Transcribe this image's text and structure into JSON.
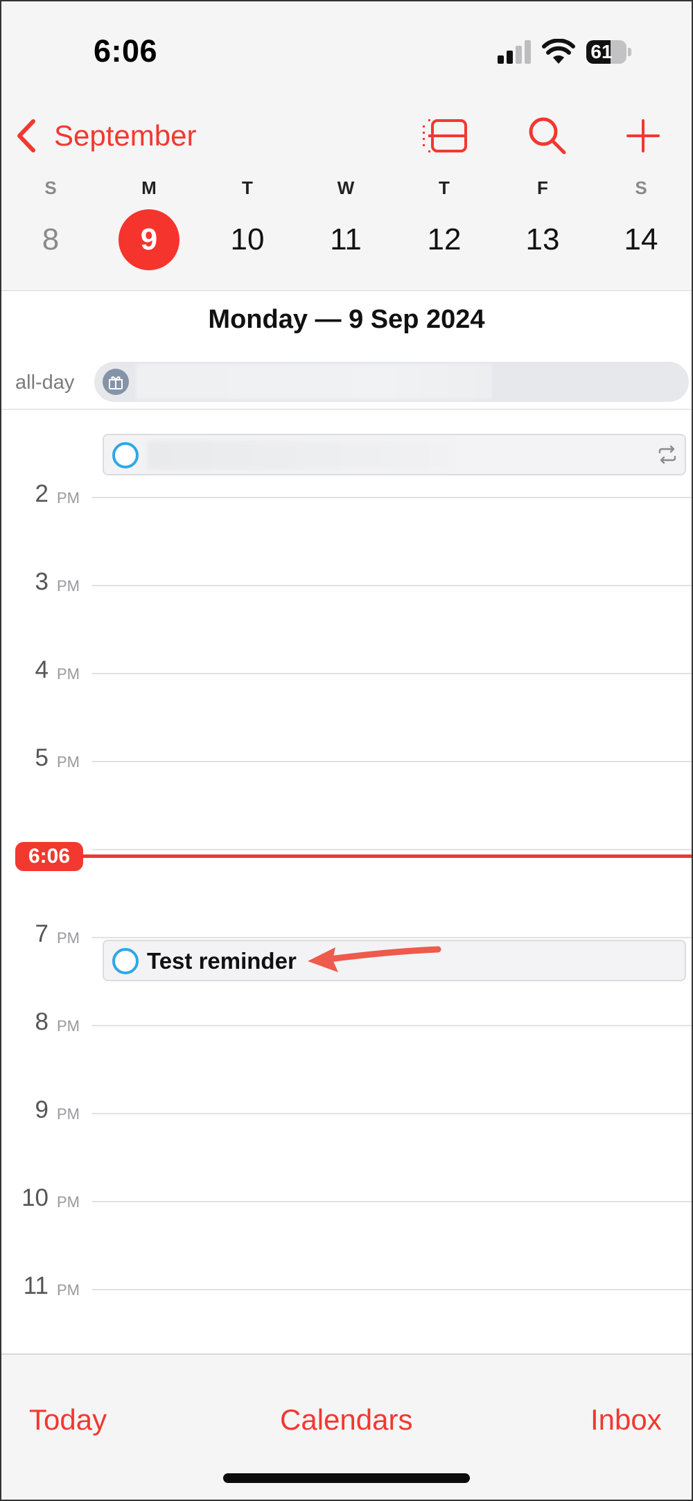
{
  "status_bar": {
    "time": "6:06",
    "battery": "61",
    "battery_level": 0.61
  },
  "nav": {
    "back_label": "September"
  },
  "week": {
    "days": [
      {
        "letter": "S",
        "number": "8"
      },
      {
        "letter": "M",
        "number": "9"
      },
      {
        "letter": "T",
        "number": "10"
      },
      {
        "letter": "W",
        "number": "11"
      },
      {
        "letter": "T",
        "number": "12"
      },
      {
        "letter": "F",
        "number": "13"
      },
      {
        "letter": "S",
        "number": "14"
      }
    ]
  },
  "day_title": "Monday — 9 Sep 2024",
  "allday_label": "all-day",
  "timeline": {
    "first_hour": "1",
    "hours": [
      {
        "num": "2",
        "suffix": "PM"
      },
      {
        "num": "3",
        "suffix": "PM"
      },
      {
        "num": "4",
        "suffix": "PM"
      },
      {
        "num": "5",
        "suffix": "PM"
      },
      {
        "num": "7",
        "suffix": "PM"
      },
      {
        "num": "8",
        "suffix": "PM"
      },
      {
        "num": "9",
        "suffix": "PM"
      },
      {
        "num": "10",
        "suffix": "PM"
      },
      {
        "num": "11",
        "suffix": "PM"
      }
    ],
    "pm": "PM",
    "now_label": "6:06",
    "reminder_title": "Test reminder"
  },
  "tabs": {
    "today": "Today",
    "calendars": "Calendars",
    "inbox": "Inbox"
  },
  "colors": {
    "accent": "#f2382f",
    "reminder_circle": "#2ea8e6"
  }
}
